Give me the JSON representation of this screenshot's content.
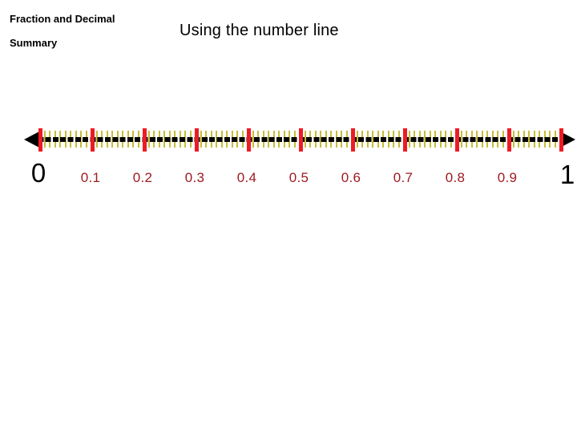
{
  "slide": {
    "subtitle": "Fraction and Decimal\nSummary",
    "title": "Using the number line"
  },
  "number_line": {
    "start_label": "0",
    "end_label": "1",
    "major_tick_color": "#ee1b24",
    "minor_tick_color": "#c8bc3a",
    "rail_color": "#000000",
    "label_color": "#9e1b20",
    "endpoint_label_color": "#000000",
    "minor_ticks_per_interval": 9,
    "tick_labels": [
      {
        "value": "0.1"
      },
      {
        "value": "0.2"
      },
      {
        "value": "0.3"
      },
      {
        "value": "0.4"
      },
      {
        "value": "0.5"
      },
      {
        "value": "0.6"
      },
      {
        "value": "0.7"
      },
      {
        "value": "0.8"
      },
      {
        "value": "0.9"
      }
    ],
    "major_values": [
      "0",
      "0.1",
      "0.2",
      "0.3",
      "0.4",
      "0.5",
      "0.6",
      "0.7",
      "0.8",
      "0.9",
      "1"
    ]
  }
}
